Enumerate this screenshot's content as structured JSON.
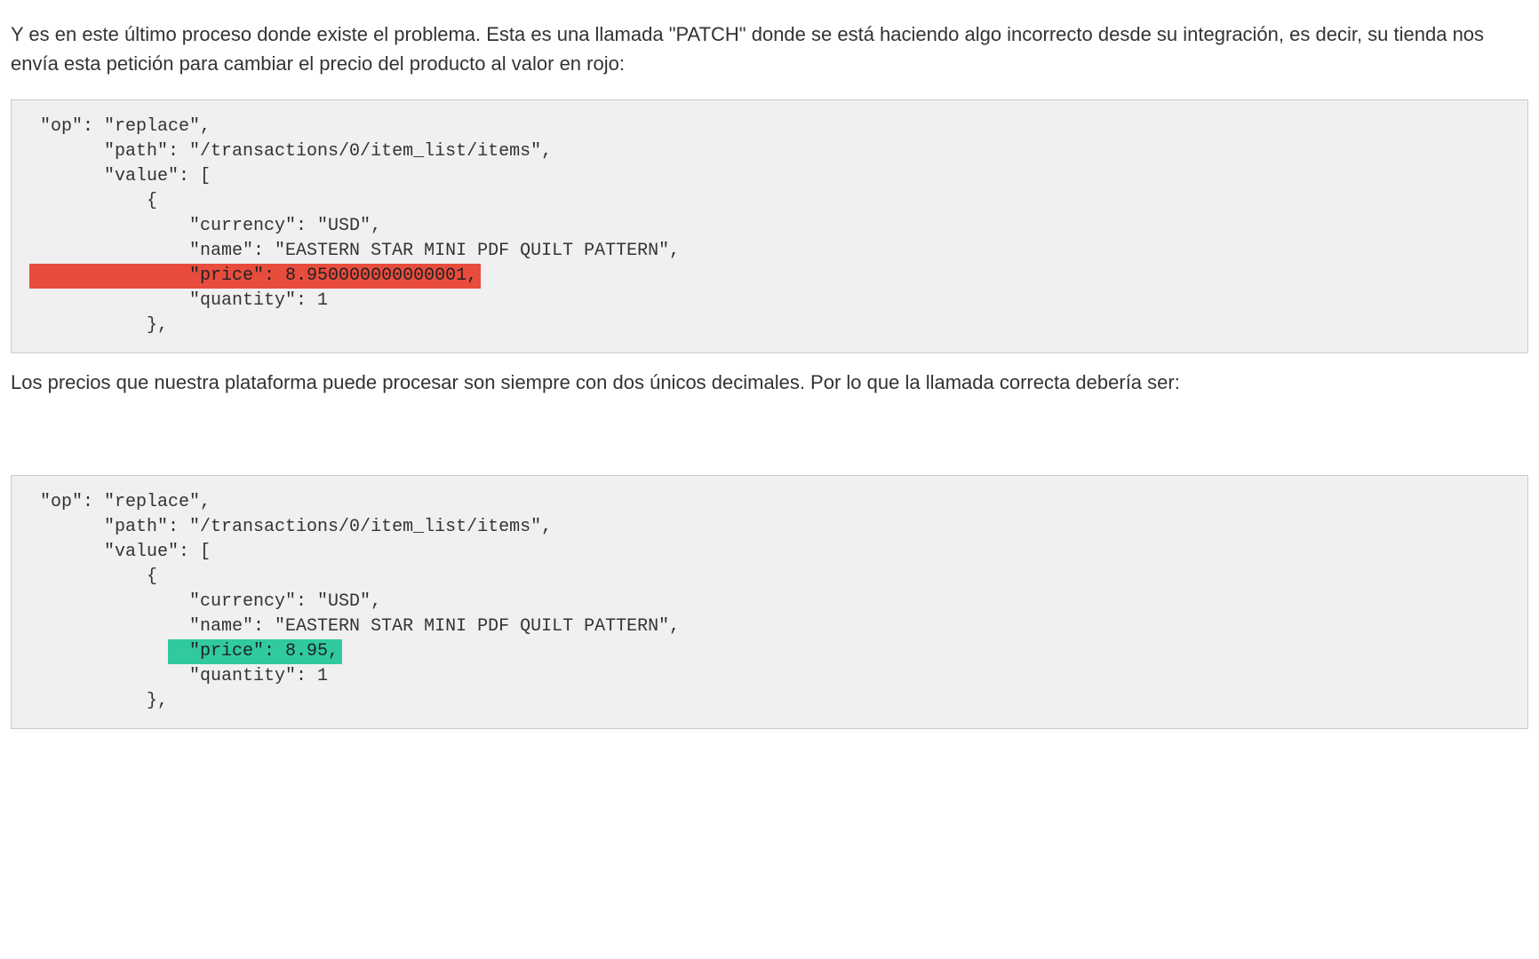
{
  "intro_paragraph": "Y es en este último proceso donde existe el problema. Esta es una llamada \"PATCH\" donde se está haciendo algo incorrecto desde su integración, es decir, su tienda nos envía esta petición para cambiar el precio del producto al valor en rojo:",
  "middle_paragraph": "Los precios que nuestra plataforma puede procesar son siempre con dos únicos decimales. Por lo que la llamada correcta debería ser:",
  "code_block_1": {
    "line1": " \"op\": \"replace\",",
    "line2": "       \"path\": \"/transactions/0/item_list/items\",",
    "line3": "       \"value\": [",
    "line4": "           {",
    "line5": "               \"currency\": \"USD\",",
    "line6": "               \"name\": \"EASTERN STAR MINI PDF QUILT PATTERN\",",
    "highlight_line": "               \"price\": 8.950000000000001,",
    "line8": "               \"quantity\": 1",
    "line9": "           },"
  },
  "code_block_2": {
    "line1": " \"op\": \"replace\",",
    "line2": "       \"path\": \"/transactions/0/item_list/items\",",
    "line3": "       \"value\": [",
    "line4": "           {",
    "line5": "               \"currency\": \"USD\",",
    "line6": "               \"name\": \"EASTERN STAR MINI PDF QUILT PATTERN\",",
    "highlight_prefix": "             ",
    "highlight_content": "  \"price\": 8.95,",
    "line8": "               \"quantity\": 1",
    "line9": "           },"
  }
}
